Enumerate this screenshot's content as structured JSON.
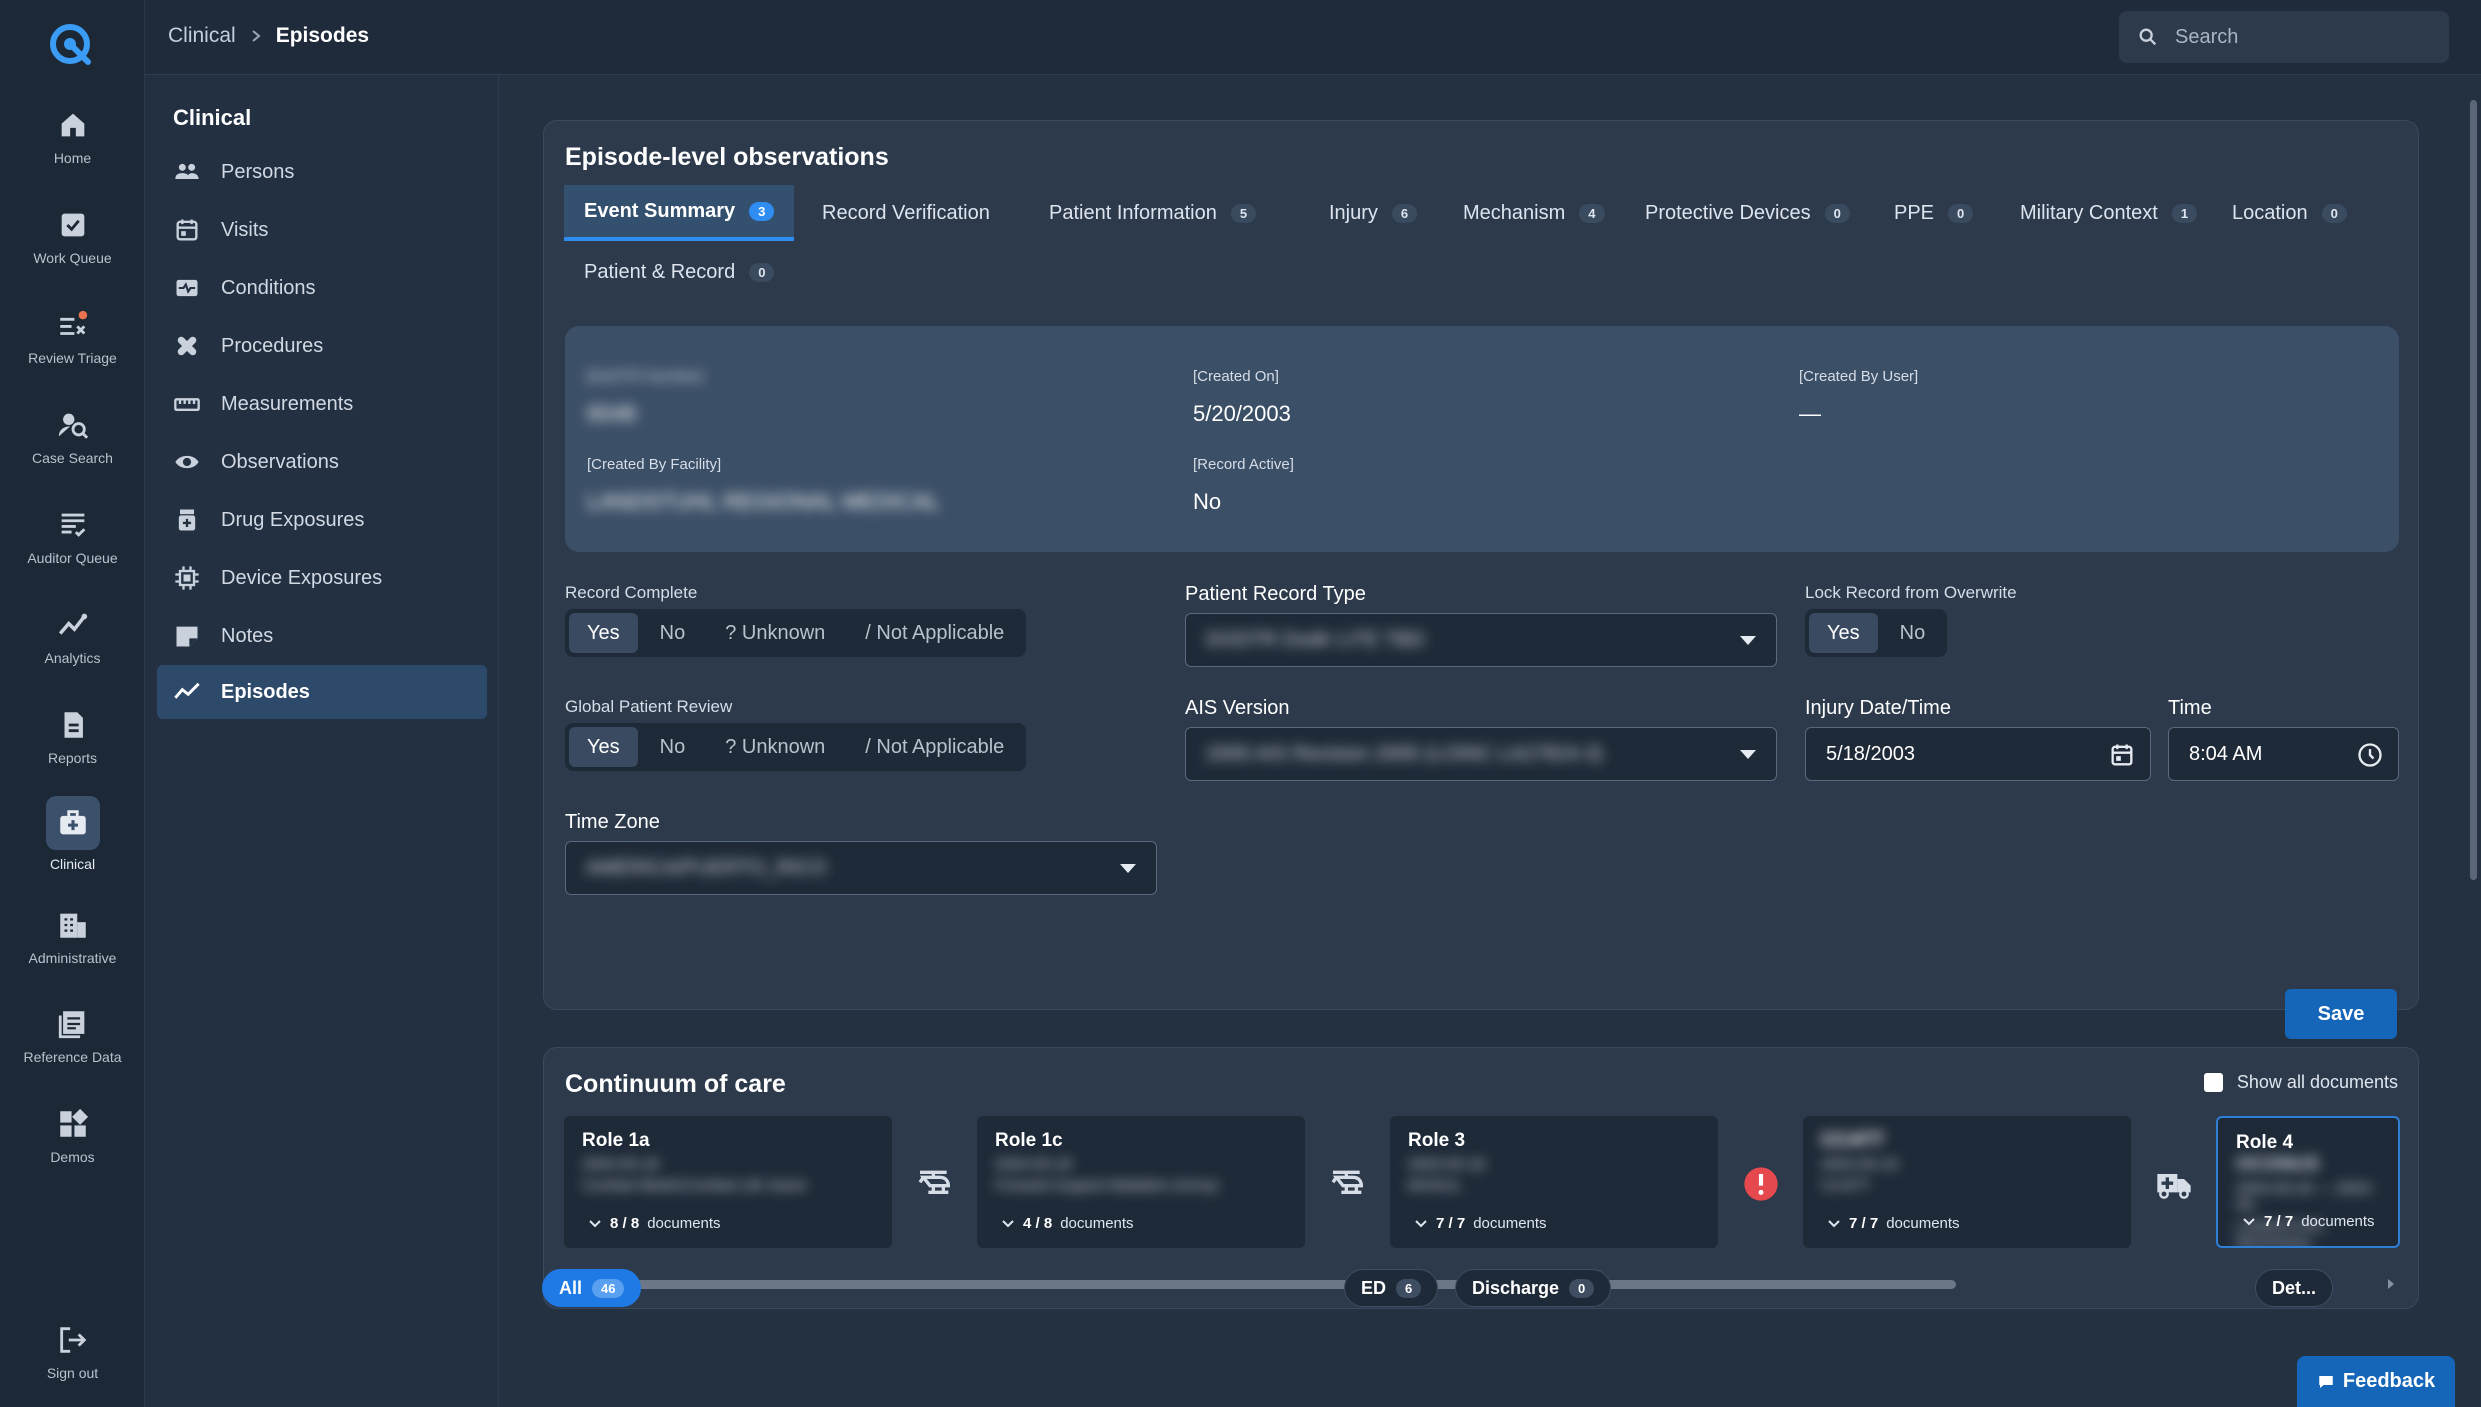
{
  "rail": {
    "items": [
      {
        "label": "Home",
        "icon": "home-icon"
      },
      {
        "label": "Work Queue",
        "icon": "work-queue-icon"
      },
      {
        "label": "Review Triage",
        "icon": "review-triage-icon"
      },
      {
        "label": "Case Search",
        "icon": "case-search-icon"
      },
      {
        "label": "Auditor Queue",
        "icon": "auditor-queue-icon"
      },
      {
        "label": "Analytics",
        "icon": "analytics-icon"
      },
      {
        "label": "Reports",
        "icon": "reports-icon"
      },
      {
        "label": "Clinical",
        "icon": "clinical-icon"
      },
      {
        "label": "Administrative",
        "icon": "administrative-icon"
      },
      {
        "label": "Reference Data",
        "icon": "reference-data-icon"
      },
      {
        "label": "Demos",
        "icon": "demos-icon"
      }
    ],
    "sign_out": "Sign out"
  },
  "header": {
    "breadcrumb_parent": "Clinical",
    "breadcrumb_current": "Episodes",
    "search_placeholder": "Search"
  },
  "sidenav": {
    "heading": "Clinical",
    "items": [
      {
        "label": "Persons"
      },
      {
        "label": "Visits"
      },
      {
        "label": "Conditions"
      },
      {
        "label": "Procedures"
      },
      {
        "label": "Measurements"
      },
      {
        "label": "Observations"
      },
      {
        "label": "Drug Exposures"
      },
      {
        "label": "Device Exposures"
      },
      {
        "label": "Notes"
      },
      {
        "label": "Episodes"
      }
    ]
  },
  "observations": {
    "title": "Episode-level observations",
    "tabs": [
      {
        "label": "Event Summary",
        "count": "3"
      },
      {
        "label": "Record Verification",
        "count": ""
      },
      {
        "label": "Patient Information",
        "count": "5"
      },
      {
        "label": "Injury",
        "count": "6"
      },
      {
        "label": "Mechanism",
        "count": "4"
      },
      {
        "label": "Protective Devices",
        "count": "0"
      },
      {
        "label": "PPE",
        "count": "0"
      },
      {
        "label": "Military Context",
        "count": "1"
      },
      {
        "label": "Location",
        "count": "0"
      },
      {
        "label": "Patient & Record",
        "count": "0"
      }
    ],
    "info": {
      "dod_label": "[DoDTR Number]",
      "dod_value": "6548",
      "created_on_label": "[Created On]",
      "created_on_value": "5/20/2003",
      "created_by_user_label": "[Created By User]",
      "created_by_user_value": "—",
      "facility_label": "[Created By Facility]",
      "facility_value": "LANDSTUHL REGIONAL MEDICAL",
      "record_active_label": "[Record Active]",
      "record_active_value": "No"
    },
    "record_complete": {
      "label": "Record Complete",
      "options": [
        "Yes",
        "No",
        "? Unknown",
        "/ Not Applicable"
      ]
    },
    "global_review": {
      "label": "Global Patient Review",
      "options": [
        "Yes",
        "No",
        "? Unknown",
        "/ Not Applicable"
      ]
    },
    "patient_record_type": {
      "label": "Patient Record Type",
      "value": "DODTR Dodtr LITE TBD"
    },
    "lock_record": {
      "label": "Lock Record from Overwrite",
      "options": [
        "Yes",
        "No"
      ]
    },
    "ais_version": {
      "label": "AIS Version",
      "value": "2005 AIS Revision 2005 (LOINC LA27824-3)"
    },
    "injury_date": {
      "label": "Injury Date/Time",
      "value": "5/18/2003"
    },
    "time": {
      "label": "Time",
      "value": "8:04 AM"
    },
    "time_zone": {
      "label": "Time Zone",
      "value": "AMERICA/PUERTO_RICO"
    },
    "save_label": "Save"
  },
  "continuum": {
    "title": "Continuum of care",
    "show_all": "Show all documents",
    "roles": [
      {
        "name": "Role 1a",
        "name_extra": "",
        "date": "2003-05-18",
        "unit": "Combat Medic/Combat Life Saver",
        "docs": "8 / 8",
        "docs_suffix": "documents"
      },
      {
        "name": "Role 1c",
        "name_extra": "",
        "date": "2003-05-18",
        "unit": "Forward Support Battalion (Army)",
        "docs": "4 / 8",
        "docs_suffix": "documents"
      },
      {
        "name": "Role 3",
        "name_extra": "",
        "date": "2003-05-18",
        "unit": "MOSUL",
        "docs": "7 / 7",
        "docs_suffix": "documents"
      },
      {
        "name": "CCATT",
        "name_extra": "",
        "date": "2003-05-19",
        "unit": "CCATT",
        "docs": "7 / 7",
        "docs_suffix": "documents"
      },
      {
        "name": "Role 4",
        "name_extra": "OCONUS",
        "date": "2003-05-20 — 2003-05-",
        "unit": "LANDSTUHL REGIONAL",
        "docs": "7 / 7",
        "docs_suffix": "documents"
      }
    ],
    "connectors": [
      "helicopter-icon",
      "helicopter-icon",
      "alert-icon",
      "ambulance-icon"
    ]
  },
  "filters": [
    {
      "label": "All",
      "count": "46"
    },
    {
      "label": "ED",
      "count": "6"
    },
    {
      "label": "Discharge",
      "count": "0"
    },
    {
      "label": "Det...",
      "count": ""
    }
  ],
  "feedback_label": "Feedback"
}
